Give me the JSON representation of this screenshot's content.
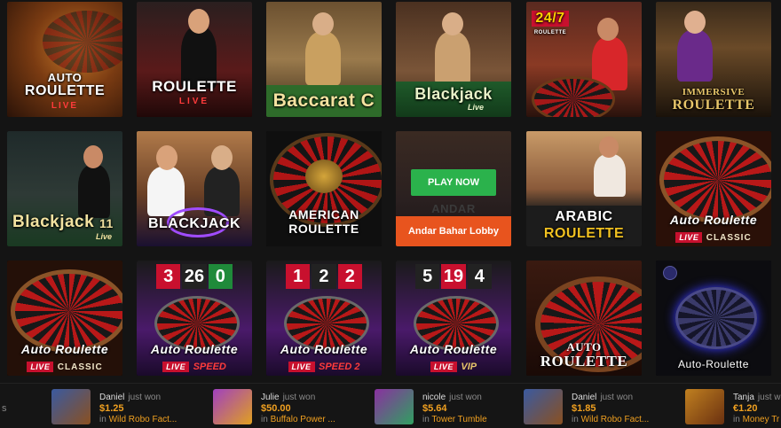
{
  "tiles": [
    {
      "line1": "AUTO",
      "line2": "ROULETTE",
      "line3": "LIVE"
    },
    {
      "line1": "ROULETTE",
      "line2": "LIVE"
    },
    {
      "line1": "Baccarat C"
    },
    {
      "line1": "Blackjack",
      "line2": "Live"
    },
    {
      "line1": "24/7",
      "line2": "ROULETTE"
    },
    {
      "line1": "IMMERSIVE",
      "line2": "ROULETTE"
    },
    {
      "line1": "Blackjack",
      "line2": "11",
      "line3": "Live"
    },
    {
      "line1": "BLACKJACK"
    },
    {
      "line1": "AMERICAN",
      "line2": "ROULETTE"
    },
    {
      "play_label": "PLAY NOW",
      "lobby_label": "Andar Bahar Lobby",
      "bg_text": "ANDAR"
    },
    {
      "line1": "ARABIC",
      "line2": "ROULETTE"
    },
    {
      "line1": "Auto Roulette",
      "line2": "LIVE",
      "line3": "CLASSIC"
    },
    {
      "line1": "Auto Roulette",
      "line2": "LIVE",
      "line3": "CLASSIC"
    },
    {
      "line1": "Auto Roulette",
      "line2": "LIVE",
      "line3": "SPEED",
      "scores": [
        "3",
        "26",
        "0"
      ]
    },
    {
      "line1": "Auto Roulette",
      "line2": "LIVE",
      "line3": "SPEED 2",
      "scores": [
        "1",
        "2",
        "2"
      ]
    },
    {
      "line1": "Auto Roulette",
      "line2": "LIVE",
      "line3": "VIP",
      "scores": [
        "5",
        "19",
        "4"
      ]
    },
    {
      "line1": "AUTO",
      "line2": "ROULETTE"
    },
    {
      "line1": "Auto-Roulette"
    }
  ],
  "ticker": [
    {
      "name": "Daniel",
      "action": "just won",
      "amount": "$1.25",
      "prefix": "in",
      "game": "Wild Robo Fact..."
    },
    {
      "name": "Julie",
      "action": "just won",
      "amount": "$50.00",
      "prefix": "in",
      "game": "Buffalo Power ..."
    },
    {
      "name": "nicole",
      "action": "just won",
      "amount": "$5.64",
      "prefix": "in",
      "game": "Tower Tumble"
    },
    {
      "name": "Daniel",
      "action": "just won",
      "amount": "$1.85",
      "prefix": "in",
      "game": "Wild Robo Fact..."
    },
    {
      "name": "Tanja",
      "action": "just won",
      "amount": "€1.20",
      "prefix": "in",
      "game": "Money Tr"
    }
  ],
  "ticker_arrow": "s"
}
